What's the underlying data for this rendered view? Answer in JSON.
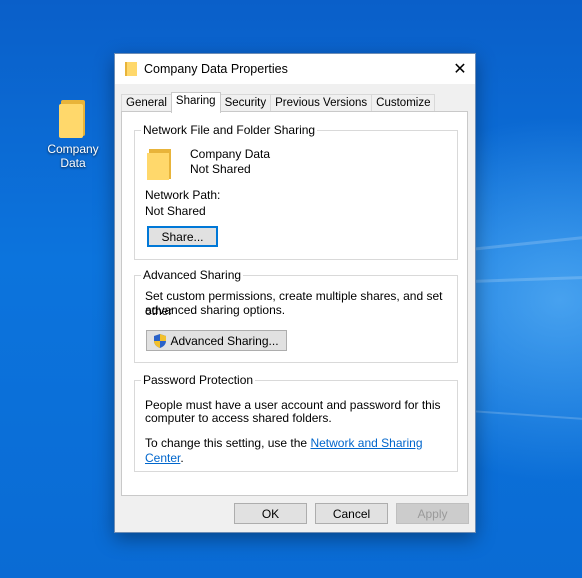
{
  "desktop": {
    "icon_label_line1": "Company",
    "icon_label_line2": "Data",
    "icon": "folder-icon"
  },
  "window": {
    "title": "Company Data Properties",
    "close_glyph": "✕"
  },
  "tabs": [
    {
      "label": "General"
    },
    {
      "label": "Sharing"
    },
    {
      "label": "Security"
    },
    {
      "label": "Previous Versions"
    },
    {
      "label": "Customize"
    }
  ],
  "network": {
    "group_title": "Network File and Folder Sharing",
    "folder_name": "Company Data",
    "folder_status": "Not Shared",
    "path_label": "Network Path:",
    "path_value": "Not Shared",
    "share_button": "Share..."
  },
  "advanced": {
    "group_title": "Advanced Sharing",
    "desc_line1": "Set custom permissions, create multiple shares, and set other",
    "desc_line2": "advanced sharing options.",
    "button": "Advanced Sharing..."
  },
  "password": {
    "group_title": "Password Protection",
    "desc_line1": "People must have a user account and password for this",
    "desc_line2": "computer to access shared folders.",
    "change_prefix": "To change this setting, use the ",
    "link": "Network and Sharing Center",
    "change_suffix": "."
  },
  "footer": {
    "ok": "OK",
    "cancel": "Cancel",
    "apply": "Apply"
  },
  "colors": {
    "desktop": "#0a6fd6",
    "folder": "#ffd86b",
    "link": "#0066cc",
    "focus": "#0078d7"
  }
}
